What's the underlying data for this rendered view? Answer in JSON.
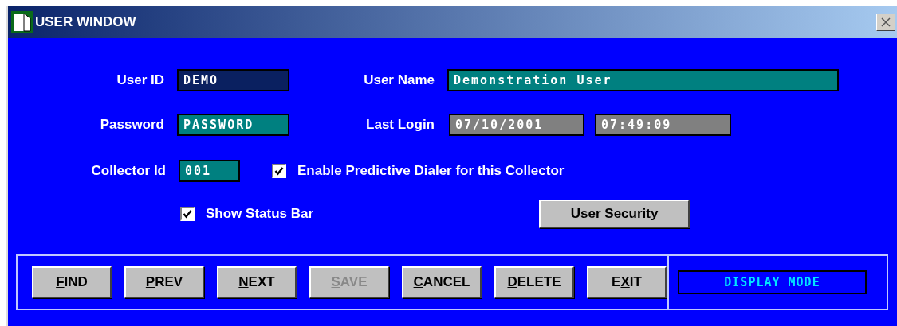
{
  "window": {
    "title": "USER WINDOW"
  },
  "fields": {
    "user_id": {
      "label": "User ID",
      "value": "DEMO"
    },
    "user_name": {
      "label": "User Name",
      "value": "Demonstration User"
    },
    "password": {
      "label": "Password",
      "value": "PASSWORD"
    },
    "last_login": {
      "label": "Last Login",
      "date": "07/10/2001",
      "time": "07:49:09"
    },
    "collector_id": {
      "label": "Collector Id",
      "value": "001"
    }
  },
  "checkboxes": [
    {
      "label": "Enable Predictive Dialer for this Collector",
      "checked": true
    },
    {
      "label": "Show Status Bar",
      "checked": true
    }
  ],
  "security_button": "User Security",
  "buttons": [
    {
      "hotkey": "F",
      "label_rest": "IND",
      "disabled": false
    },
    {
      "hotkey": "P",
      "label_rest": "REV",
      "disabled": false
    },
    {
      "hotkey": "N",
      "label_rest": "EXT",
      "disabled": false
    },
    {
      "hotkey": "S",
      "label_rest": "AVE",
      "disabled": true
    },
    {
      "hotkey": "C",
      "label_rest": "ANCEL",
      "disabled": false
    },
    {
      "hotkey": "D",
      "label_rest": "ELETE",
      "disabled": false
    },
    {
      "label_start": "E",
      "hotkey": "X",
      "label_rest": "IT",
      "disabled": false
    }
  ],
  "mode": "DISPLAY MODE"
}
